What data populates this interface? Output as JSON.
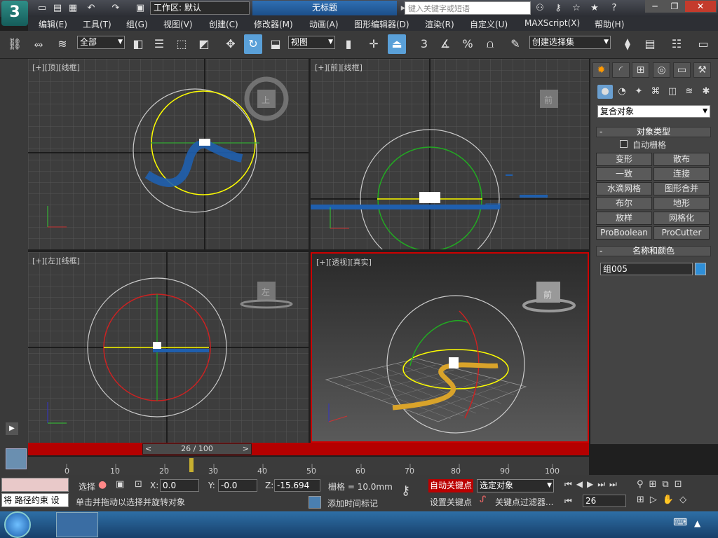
{
  "app": {
    "logo_icon": "3ds-max-logo",
    "workspace": "工作区: 默认",
    "title": "无标题",
    "search_placeholder": "键入关键字或短语",
    "window_buttons": [
      "─",
      "❐",
      "✕"
    ]
  },
  "menu": [
    "编辑(E)",
    "工具(T)",
    "组(G)",
    "视图(V)",
    "创建(C)",
    "修改器(M)",
    "动画(A)",
    "图形编辑器(D)",
    "渲染(R)",
    "自定义(U)",
    "MAXScript(X)",
    "帮助(H)"
  ],
  "toolbar": {
    "selection_filter": "全部",
    "ref_coord": "视图",
    "named_selection": "创建选择集",
    "snap_labels": [
      "3",
      "%"
    ]
  },
  "viewports": [
    {
      "label": "[+][顶][线框]",
      "cube": "上"
    },
    {
      "label": "[+][前][线框]",
      "cube": "前"
    },
    {
      "label": "[+][左][线框]",
      "cube": "左"
    },
    {
      "label": "[+][透视][真实]",
      "cube": "前"
    }
  ],
  "command_panel": {
    "category": "复合对象",
    "rollout_object_type": "对象类型",
    "auto_grid": "自动栅格",
    "buttons": [
      "变形",
      "散布",
      "一致",
      "连接",
      "水滴网格",
      "图形合并",
      "布尔",
      "地形",
      "放样",
      "网格化",
      "ProBoolean",
      "ProCutter"
    ],
    "rollout_name_color": "名称和颜色",
    "object_name": "组005",
    "object_color": "#2f8fd8"
  },
  "time": {
    "slider": "26 / 100",
    "ticks": [
      "0",
      "10",
      "20",
      "30",
      "40",
      "50",
      "60",
      "70",
      "80",
      "90",
      "100"
    ]
  },
  "status": {
    "maxscript_text": "将 路径约束 设",
    "prompt": "单击并拖动以选择并旋转对象",
    "selected_label": "选择",
    "x_label": "X:",
    "x": "0.0",
    "y_label": "Y:",
    "y": "-0.0",
    "z_label": "Z:",
    "z": "-15.694",
    "grid": "栅格 = 10.0mm",
    "add_time_tag": "添加时间标记",
    "auto_key": "自动关键点",
    "set_key": "设置关键点",
    "key_mode": "选定对象",
    "key_filters": "关键点过滤器...",
    "frame": "26"
  }
}
